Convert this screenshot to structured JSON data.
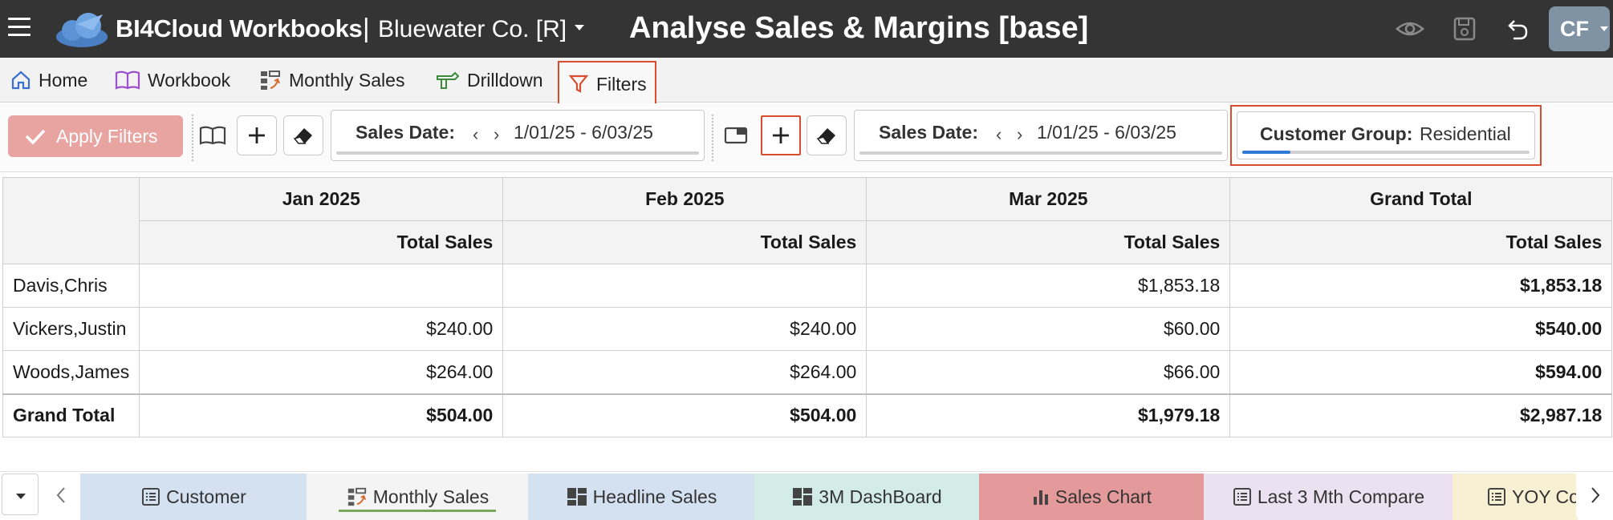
{
  "topbar": {
    "app_title": "BI4Cloud Workbooks",
    "separator": "|",
    "company": "Bluewater Co. [R]",
    "page_title": "Analyse Sales & Margins [base]",
    "avatar_initials": "CF"
  },
  "nav": {
    "items": [
      {
        "label": "Home",
        "icon": "home-icon"
      },
      {
        "label": "Workbook",
        "icon": "book-icon"
      },
      {
        "label": "Monthly Sales",
        "icon": "monthly-sales-icon"
      },
      {
        "label": "Drilldown",
        "icon": "drill-icon"
      },
      {
        "label": "Filters",
        "icon": "filter-icon",
        "active": true
      }
    ]
  },
  "toolbar": {
    "apply_label": "Apply Filters",
    "date_filter_1": {
      "label": "Sales Date:",
      "range": "1/01/25 - 6/03/25"
    },
    "date_filter_2": {
      "label": "Sales Date:",
      "range": "1/01/25 - 6/03/25"
    },
    "group_filter": {
      "label": "Customer Group:",
      "value": "Residential"
    }
  },
  "grid": {
    "months": [
      "Jan 2025",
      "Feb 2025",
      "Mar 2025",
      "Grand Total"
    ],
    "measure": "Total Sales",
    "rows": [
      {
        "name": "Davis,Chris",
        "values": [
          "",
          "",
          "$1,853.18",
          "$1,853.18"
        ]
      },
      {
        "name": "Vickers,Justin",
        "values": [
          "$240.00",
          "$240.00",
          "$60.00",
          "$540.00"
        ]
      },
      {
        "name": "Woods,James",
        "values": [
          "$264.00",
          "$264.00",
          "$66.00",
          "$594.00"
        ]
      }
    ],
    "total": {
      "name": "Grand Total",
      "values": [
        "$504.00",
        "$504.00",
        "$1,979.18",
        "$2,987.18"
      ]
    }
  },
  "sheet_tabs": [
    {
      "label": "Customer",
      "color": "#d4e1f1"
    },
    {
      "label": "Monthly Sales",
      "color": "#f4f4f4",
      "active": true
    },
    {
      "label": "Headline Sales",
      "color": "#d4e1f1"
    },
    {
      "label": "3M DashBoard",
      "color": "#d3ece6"
    },
    {
      "label": "Sales Chart",
      "color": "#e49a9a"
    },
    {
      "label": "Last 3 Mth Compare",
      "color": "#ece1f1"
    },
    {
      "label": "YOY Co",
      "color": "#f8f0d2"
    }
  ],
  "colors": {
    "topbar_bg": "#343434",
    "apply_button": "#e8a4a1",
    "highlight_border": "#d94d2f",
    "filter_progress": "#2e7bd6"
  }
}
